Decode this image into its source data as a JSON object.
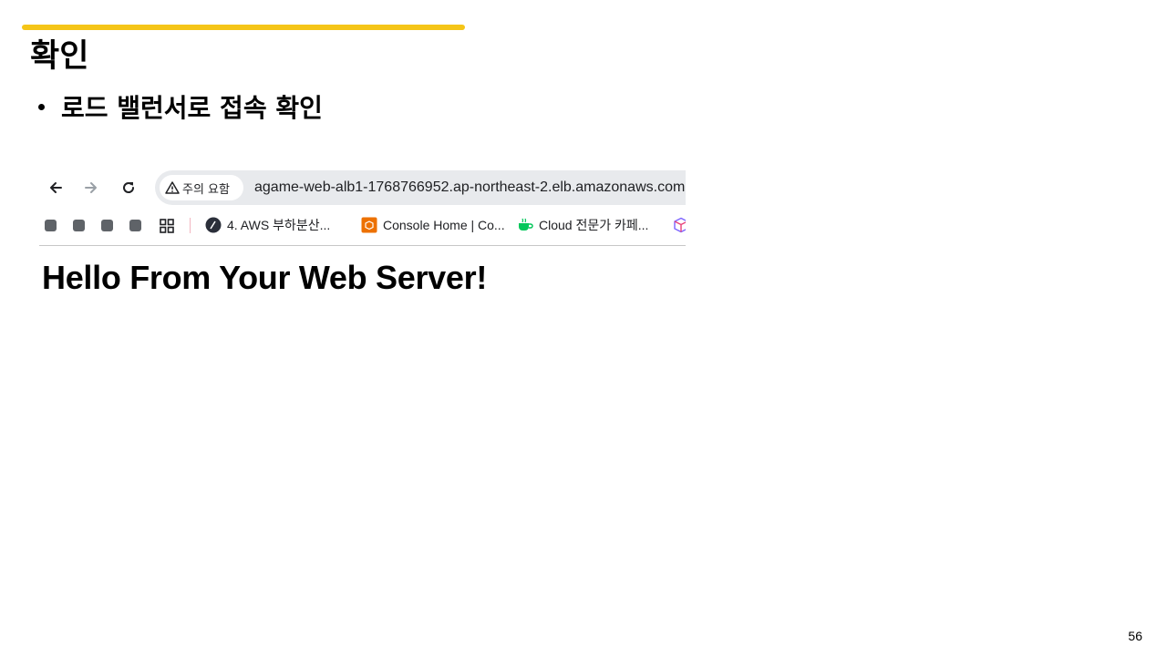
{
  "slide": {
    "title": "확인",
    "bullet": "로드 밸런서로 접속 확인",
    "page_number": "56",
    "accent_color": "#f5c518"
  },
  "browser": {
    "nav": {
      "back_icon": "arrow-left-icon",
      "forward_icon": "arrow-right-icon",
      "reload_icon": "reload-icon"
    },
    "omnibox": {
      "security_label": "주의 요함",
      "security_icon": "warning-triangle-icon",
      "url": "agame-web-alb1-1768766952.ap-northeast-2.elb.amazonaws.com"
    },
    "bookmarks": [
      {
        "label": "4. AWS 부하분산...",
        "icon": "aws-circle-icon"
      },
      {
        "label": "Console Home | Co...",
        "icon": "aws-box-icon"
      },
      {
        "label": "Cloud 전문가 카페...",
        "icon": "cafe-cup-icon"
      }
    ],
    "page": {
      "heading": "Hello From Your Web Server!"
    }
  }
}
